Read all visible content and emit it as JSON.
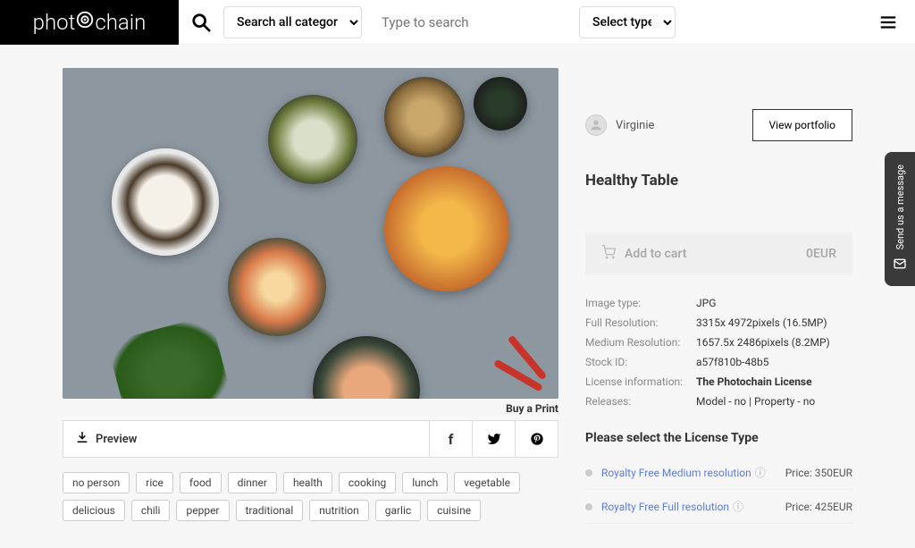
{
  "header": {
    "logo_pre": "phot",
    "logo_post": "chain",
    "category_select": "Search all categories",
    "search_placeholder": "Type to search",
    "type_select": "Select type"
  },
  "photo": {
    "buy_print": "Buy a Print",
    "preview": "Preview"
  },
  "tags": [
    "no person",
    "rice",
    "food",
    "dinner",
    "health",
    "cooking",
    "lunch",
    "vegetable",
    "delicious",
    "chili",
    "pepper",
    "traditional",
    "nutrition",
    "garlic",
    "cuisine"
  ],
  "author": {
    "name": "Virginie",
    "portfolio_btn": "View portfolio"
  },
  "title": "Healthy Table",
  "cart": {
    "label": "Add to cart",
    "price": "0EUR"
  },
  "meta": {
    "rows": [
      {
        "label": "Image type:",
        "value": "JPG",
        "link": false
      },
      {
        "label": "Full Resolution:",
        "value": "3315x 4972pixels (16.5MP)",
        "link": false
      },
      {
        "label": "Medium Resolution:",
        "value": "1657.5x 2486pixels (8.2MP)",
        "link": false
      },
      {
        "label": "Stock ID:",
        "value": "a57f810b-48b5",
        "link": false
      },
      {
        "label": "License information:",
        "value": "The Photochain License",
        "link": true
      },
      {
        "label": "Releases:",
        "value": "Model - no | Property - no",
        "link": false
      }
    ]
  },
  "license": {
    "title": "Please select the License Type",
    "options": [
      {
        "name": "Royalty Free Medium resolution",
        "price": "Price: 350EUR"
      },
      {
        "name": "Royalty Free Full resolution",
        "price": "Price: 425EUR"
      }
    ]
  },
  "side_tab": "Send us a message"
}
